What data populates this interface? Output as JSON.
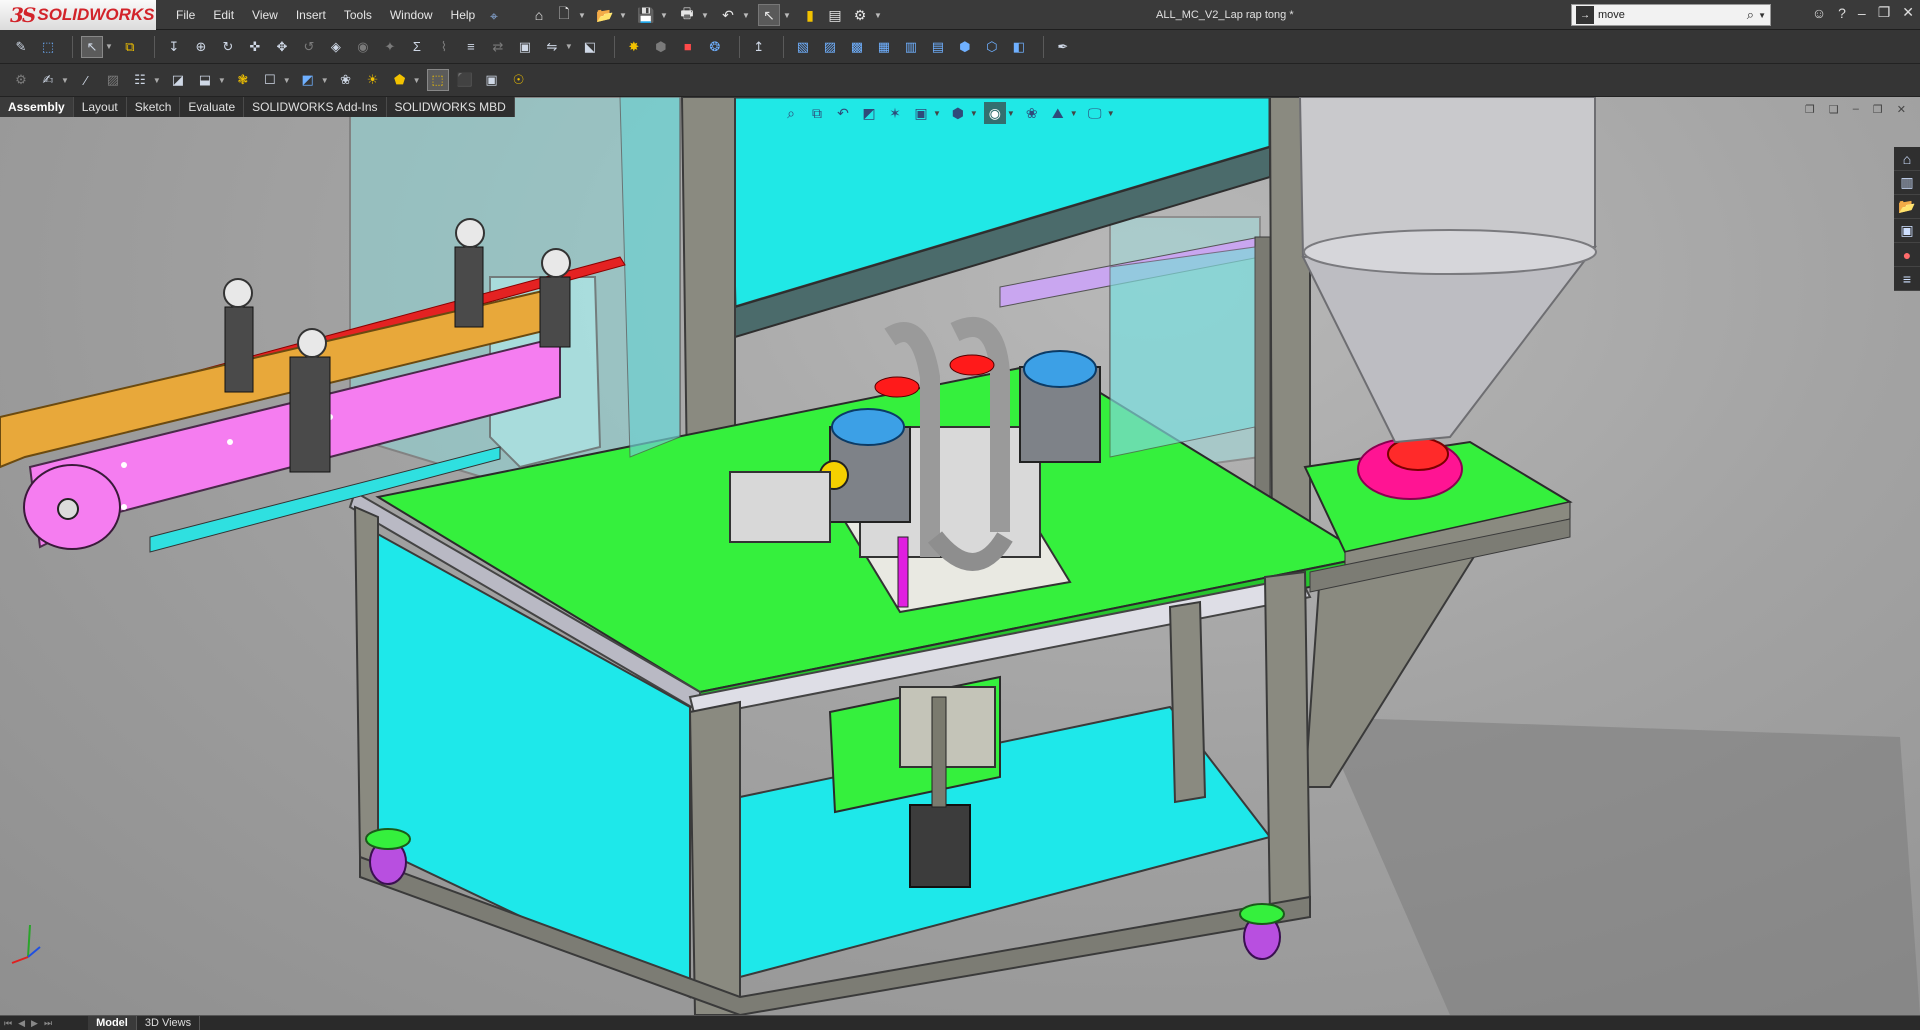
{
  "app": {
    "logo_ds": "3S",
    "logo_brand": "SOLIDWORKS",
    "document_title": "ALL_MC_V2_Lap rap tong *"
  },
  "menu": [
    "File",
    "Edit",
    "View",
    "Insert",
    "Tools",
    "Window",
    "Help"
  ],
  "search": {
    "value": "move",
    "icon": "command-search-icon"
  },
  "command_tabs": [
    {
      "label": "Assembly",
      "active": true
    },
    {
      "label": "Layout",
      "active": false
    },
    {
      "label": "Sketch",
      "active": false
    },
    {
      "label": "Evaluate",
      "active": false
    },
    {
      "label": "SOLIDWORKS Add-Ins",
      "active": false
    },
    {
      "label": "SOLIDWORKS MBD",
      "active": false
    }
  ],
  "bottom_tabs": [
    {
      "label": "Model",
      "active": true
    },
    {
      "label": "3D Views",
      "active": false
    }
  ],
  "colors": {
    "frame_cyan": "#26e3e3",
    "platform_green": "#35f03d",
    "conveyor_pink": "#f57df0",
    "chain_yellow": "#e8a83a",
    "flange_magenta": "#ff1493",
    "hopper_grey": "#c9c9cc",
    "frame_steel": "#8a8a84",
    "valve_blue": "#3ca0e6",
    "wheel_purple": "#b84fe0"
  }
}
